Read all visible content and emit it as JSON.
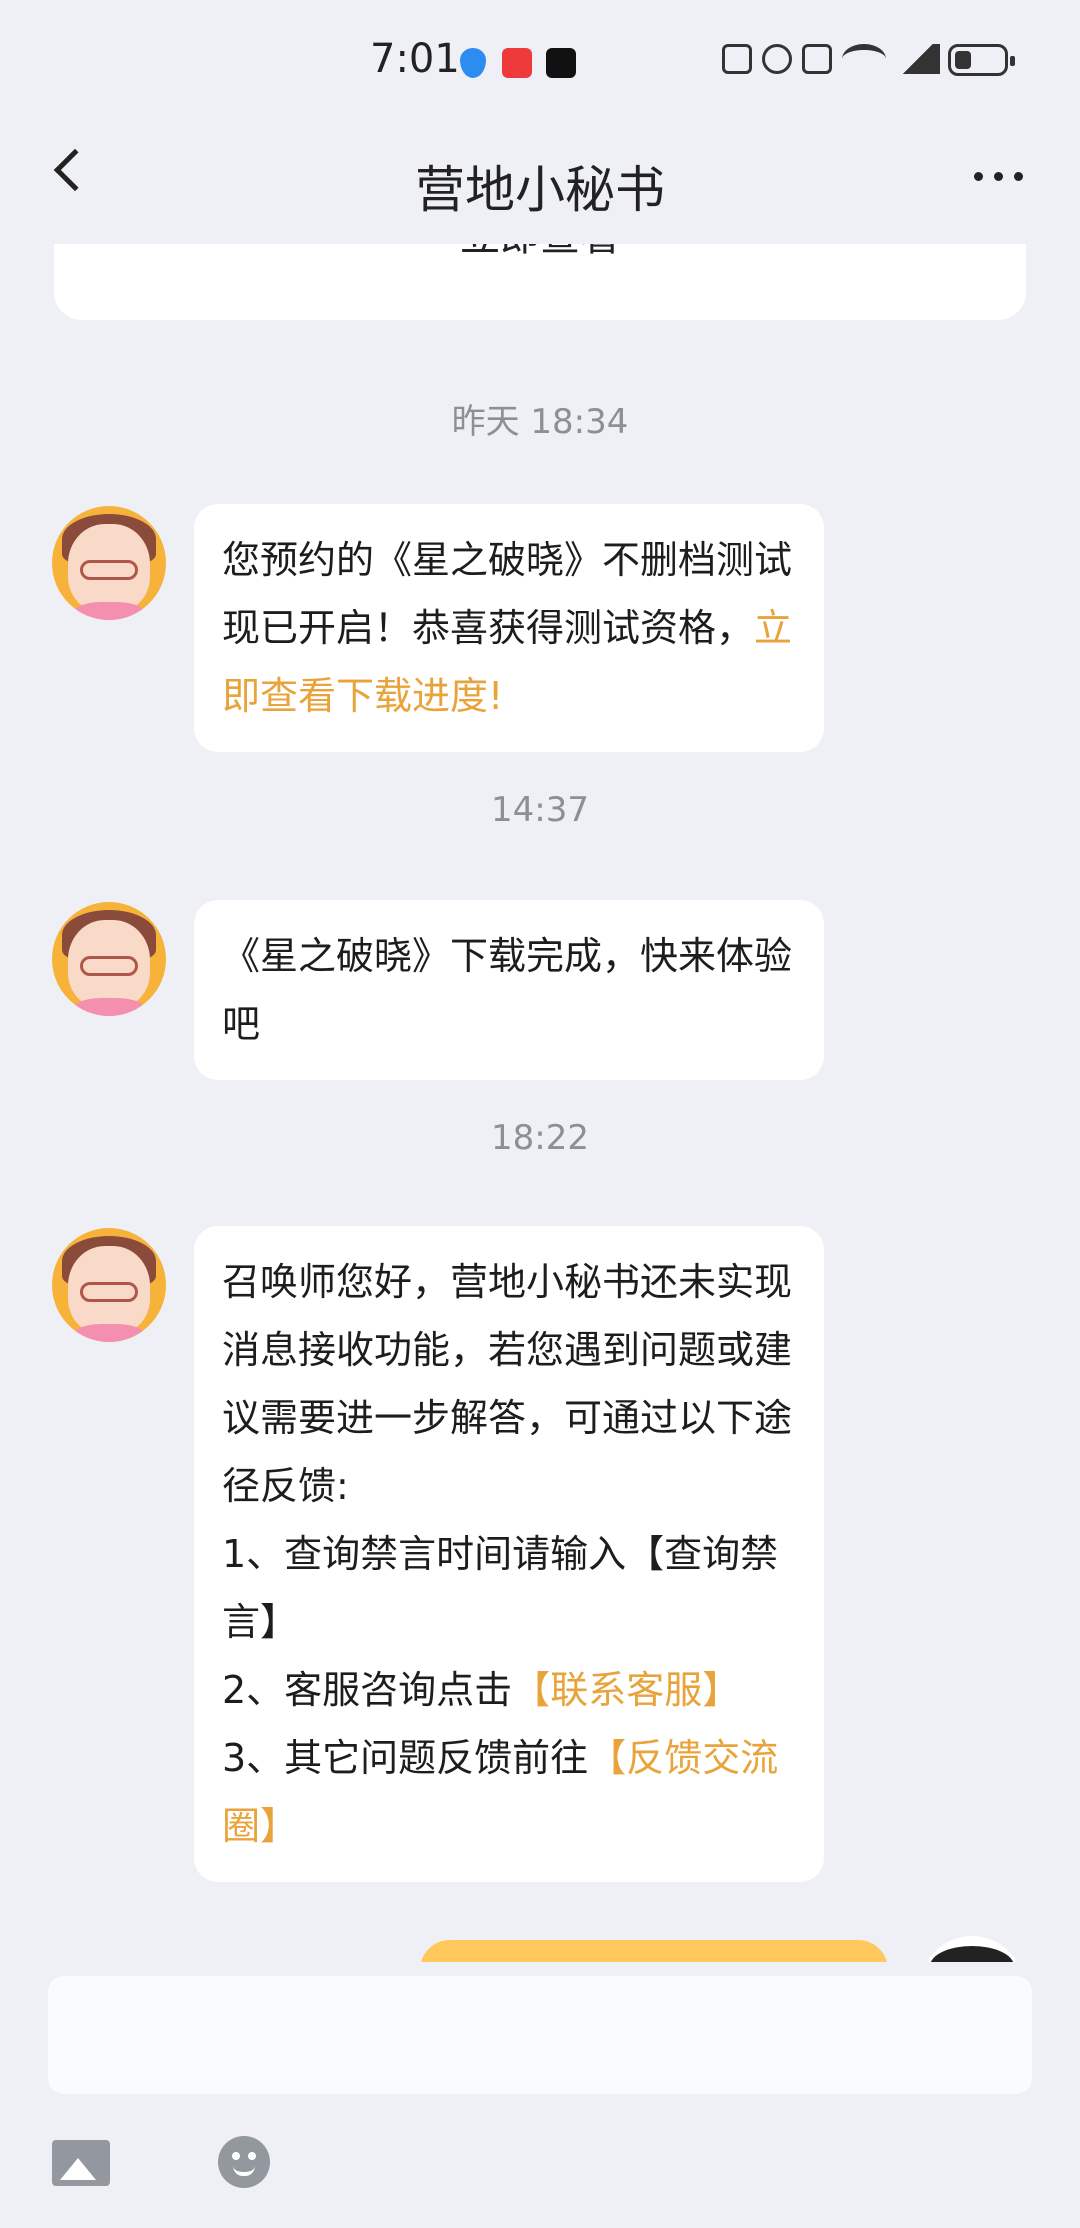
{
  "status_bar": {
    "time": "7:01",
    "icons": [
      "shield-app-icon",
      "huawei-app-icon",
      "dewu-app-icon",
      "nfc-icon",
      "alarm-icon",
      "vibrate-icon",
      "wifi-icon",
      "5g-signal-icon",
      "battery-icon"
    ],
    "battery_level": 0.35
  },
  "header": {
    "title": "营地小秘书"
  },
  "chat": {
    "previous_card_label": "立即查看",
    "messages": [
      {
        "timestamp": "昨天 18:34",
        "text": "您预约的《星之破晓》不删档测试现已开启！恭喜获得测试资格，",
        "link": "立即查看下载进度!"
      },
      {
        "timestamp": "14:37",
        "text": "《星之破晓》下载完成，快来体验吧"
      },
      {
        "timestamp": "18:22",
        "intro": "召唤师您好，营地小秘书还未实现消息接收功能，若您遇到问题或建议需要进一步解答，可通过以下途径反馈:",
        "line1": "1、查询禁言时间请输入【查询禁言】",
        "line2_prefix": "2、客服咨询点击",
        "line2_link": "【联系客服】",
        "line3_prefix": "3、其它问题反馈前往",
        "line3_link": "【反馈交流圈】"
      }
    ]
  },
  "input": {
    "placeholder": ""
  },
  "colors": {
    "background": "#eff0f5",
    "bubble": "#ffffff",
    "link": "#e8a33a",
    "timestamp": "#8d8f96",
    "own_bubble": "#ffc85a"
  }
}
